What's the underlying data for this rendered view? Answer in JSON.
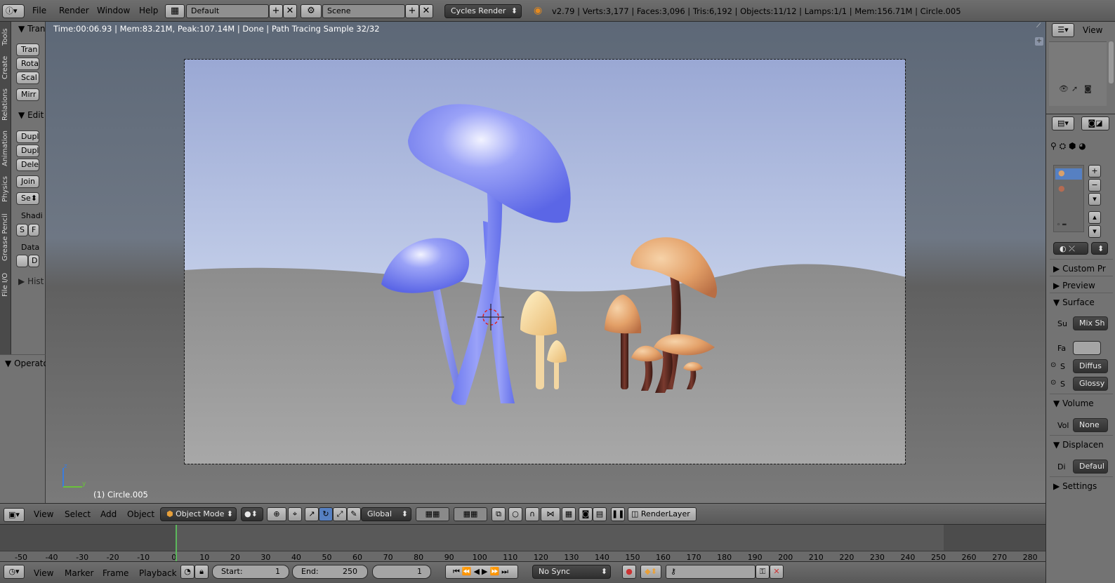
{
  "topbar": {
    "menus": [
      "File",
      "Render",
      "Window",
      "Help"
    ],
    "layout_name": "Default",
    "scene_name": "Scene",
    "render_engine": "Cycles Render",
    "stats": "v2.79 | Verts:3,177 | Faces:3,096 | Tris:6,192 | Objects:11/12 | Lamps:1/1 | Mem:156.71M | Circle.005"
  },
  "tool_tabs": [
    "Tools",
    "Create",
    "Relations",
    "Animation",
    "Physics",
    "Grease Pencil",
    "File I/O"
  ],
  "tool_panel": {
    "transform_header": "Tran",
    "translate": "Tran",
    "rotate": "Rota",
    "scale": "Scal",
    "mirror": "Mirr",
    "edit_header": "Edit",
    "duplicate": "Dupl",
    "duplicate_linked": "Dupl",
    "delete": "Dele",
    "join": "Join",
    "set_origin": "Se",
    "shading_label": "Shadi",
    "shade_smooth": "S",
    "shade_flat": "F",
    "data_label": "Data",
    "data_btn": "D",
    "history_header": "Hist"
  },
  "operator_panel": {
    "header": "Operato"
  },
  "viewport": {
    "render_status": "Time:00:06.93 | Mem:83.21M, Peak:107.14M | Done | Path Tracing Sample 32/32",
    "object_label": "(1) Circle.005",
    "axis_z": "z",
    "axis_y": "y"
  },
  "viewport_header": {
    "menus": [
      "View",
      "Select",
      "Add",
      "Object"
    ],
    "mode": "Object Mode",
    "orientation": "Global",
    "render_layer": "RenderLayer"
  },
  "timeline": {
    "ticks": [
      "-50",
      "-40",
      "-30",
      "-20",
      "-10",
      "0",
      "10",
      "20",
      "30",
      "40",
      "50",
      "60",
      "70",
      "80",
      "90",
      "100",
      "110",
      "120",
      "130",
      "140",
      "150",
      "160",
      "170",
      "180",
      "190",
      "200",
      "210",
      "220",
      "230",
      "240",
      "250",
      "260",
      "270",
      "280"
    ],
    "menus": [
      "View",
      "Marker",
      "Frame",
      "Playback"
    ],
    "start_label": "Start:",
    "start_value": "1",
    "end_label": "End:",
    "end_value": "250",
    "current_frame": "1",
    "sync": "No Sync"
  },
  "outliner": {
    "view_menu": "View"
  },
  "properties": {
    "custom_props": "Custom Pr",
    "preview": "Preview",
    "surface": "Surface",
    "surface_label": "Su",
    "surface_value": "Mix Sh",
    "factor_label": "Fa",
    "shader1_label": "S",
    "shader1_value": "Diffus",
    "shader2_label": "S",
    "shader2_value": "Glossy",
    "volume": "Volume",
    "volume_label": "Vol",
    "volume_value": "None",
    "displacement": "Displacen",
    "disp_label": "Di",
    "disp_value": "Defaul",
    "settings": "Settings"
  },
  "colors": {
    "cap_blue": "#7b86f2",
    "cap_orange": "#e2a46a",
    "stem_brown": "#5a2a22",
    "yellow_mushroom": "#f5d39a",
    "sky": "#a7b4de",
    "ground": "#8a8a8a",
    "playhead": "#5cb85c"
  }
}
